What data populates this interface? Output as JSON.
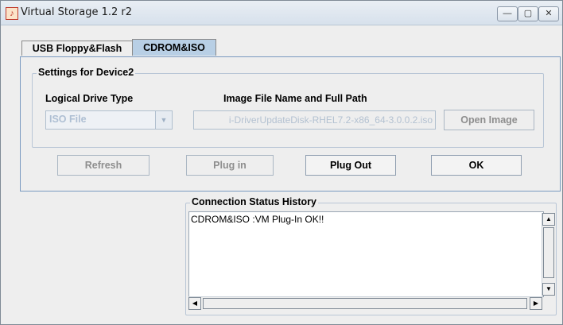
{
  "window": {
    "title": "Virtual Storage 1.2 r2",
    "controls": {
      "minimize_icon": "minimize-icon",
      "maximize_icon": "maximize-icon",
      "close_icon": "close-icon"
    }
  },
  "tabs": [
    {
      "label": "USB Floppy&Flash",
      "selected": false
    },
    {
      "label": "CDROM&ISO",
      "selected": true
    }
  ],
  "settings": {
    "group_title": "Settings for Device2",
    "drive_type_label": "Logical Drive Type",
    "drive_type_value": "ISO File",
    "path_label": "Image File Name and Full Path",
    "path_value": "i-DriverUpdateDisk-RHEL7.2-x86_64-3.0.0.2.iso",
    "open_image_label": "Open Image"
  },
  "actions": {
    "refresh_label": "Refresh",
    "plug_in_label": "Plug in",
    "plug_out_label": "Plug Out",
    "ok_label": "OK"
  },
  "history": {
    "title": "Connection Status History",
    "lines": [
      "CDROM&ISO :VM Plug-In OK!!"
    ]
  },
  "colors": {
    "selected_tab": "#b8cfe5",
    "panel_border": "#7a9ac0"
  }
}
